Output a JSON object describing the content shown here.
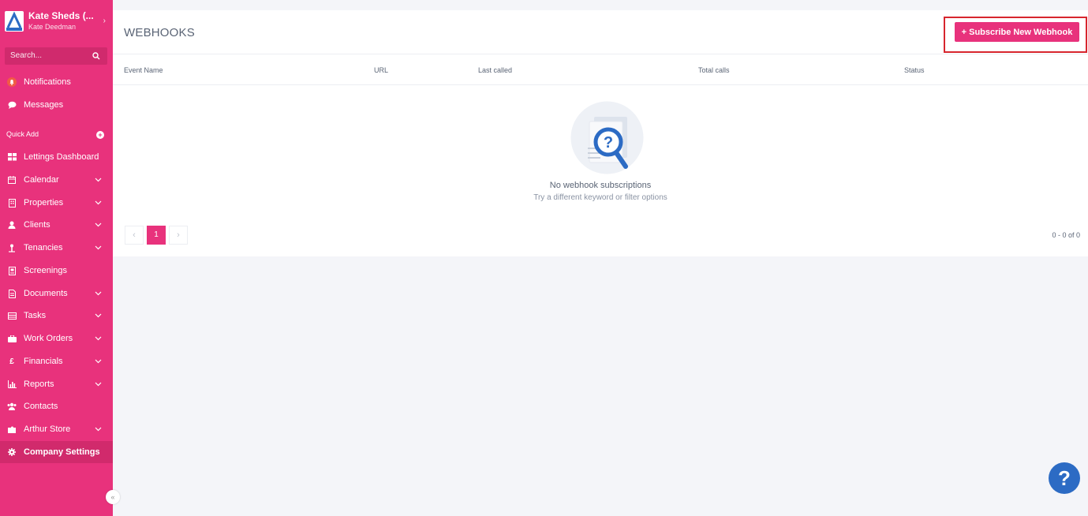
{
  "sidebar": {
    "brand_name": "Kate Sheds (...",
    "brand_user": "Kate Deedman",
    "search_placeholder": "Search...",
    "top_items": [
      {
        "label": "Notifications",
        "icon": "bell-icon"
      },
      {
        "label": "Messages",
        "icon": "chat-icon"
      }
    ],
    "quick_add_label": "Quick Add",
    "items": [
      {
        "label": "Lettings Dashboard",
        "icon": "dashboard-icon",
        "chevron": false
      },
      {
        "label": "Calendar",
        "icon": "calendar-icon",
        "chevron": true
      },
      {
        "label": "Properties",
        "icon": "building-icon",
        "chevron": true
      },
      {
        "label": "Clients",
        "icon": "user-icon",
        "chevron": true
      },
      {
        "label": "Tenancies",
        "icon": "key-icon",
        "chevron": true
      },
      {
        "label": "Screenings",
        "icon": "id-card-icon",
        "chevron": false
      },
      {
        "label": "Documents",
        "icon": "document-icon",
        "chevron": true
      },
      {
        "label": "Tasks",
        "icon": "list-icon",
        "chevron": true
      },
      {
        "label": "Work Orders",
        "icon": "briefcase-icon",
        "chevron": true
      },
      {
        "label": "Financials",
        "icon": "pound-icon",
        "chevron": true
      },
      {
        "label": "Reports",
        "icon": "bar-chart-icon",
        "chevron": true
      },
      {
        "label": "Contacts",
        "icon": "contacts-icon",
        "chevron": false
      },
      {
        "label": "Arthur Store",
        "icon": "puzzle-icon",
        "chevron": true
      },
      {
        "label": "Company Settings",
        "icon": "gear-icon",
        "chevron": false,
        "active": true
      }
    ]
  },
  "main": {
    "title": "WEBHOOKS",
    "subscribe_button": "+ Subscribe New Webhook",
    "columns": [
      "Event Name",
      "URL",
      "Last called",
      "Total calls",
      "Status"
    ],
    "empty_title": "No webhook subscriptions",
    "empty_subtitle": "Try a different keyword or filter options",
    "pagination": {
      "prev": "‹",
      "current": "1",
      "next": "›",
      "range": "0 - 0 of 0"
    }
  },
  "help_label": "?",
  "colors": {
    "brand": "#e8327c",
    "highlight": "#d7262e",
    "help": "#2c6bc4"
  }
}
